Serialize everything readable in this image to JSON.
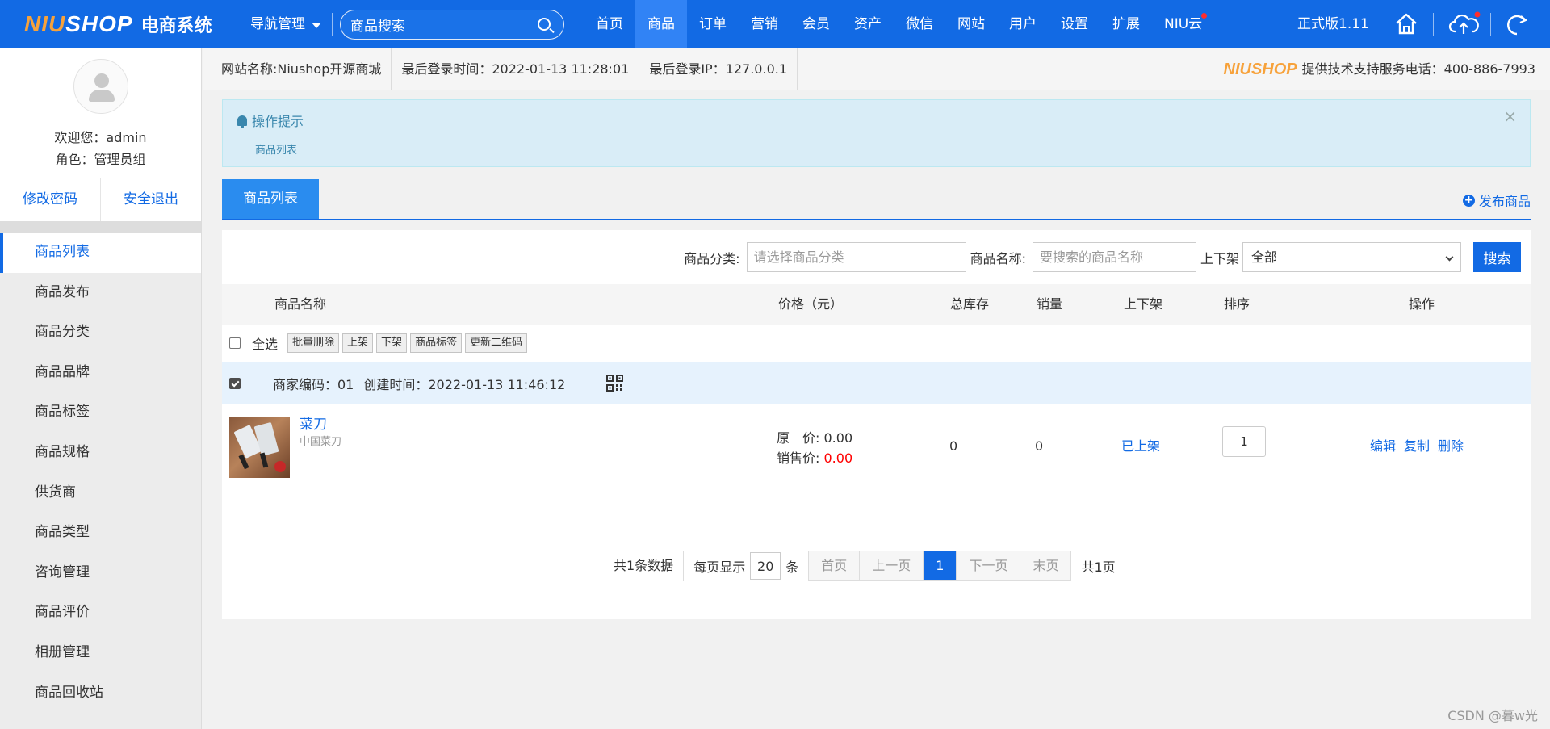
{
  "topbar": {
    "logo": {
      "part1": "NIU",
      "part2": "SHOP",
      "part3": "电商系统"
    },
    "nav_manage": "导航管理",
    "search_value": "商品搜索",
    "nav": [
      "首页",
      "商品",
      "订单",
      "营销",
      "会员",
      "资产",
      "微信",
      "网站",
      "用户",
      "设置",
      "扩展",
      "NIU云"
    ],
    "active_nav": "商品",
    "version": "正式版1.11",
    "icons": [
      "home-icon",
      "cloud-upload-icon",
      "refresh-icon"
    ]
  },
  "sidebar": {
    "welcome": "欢迎您：admin",
    "role": "角色：管理员组",
    "change_password": "修改密码",
    "logout": "安全退出",
    "menu": [
      "商品列表",
      "商品发布",
      "商品分类",
      "商品品牌",
      "商品标签",
      "商品规格",
      "供货商",
      "商品类型",
      "咨询管理",
      "商品评价",
      "相册管理",
      "商品回收站"
    ],
    "active_menu": "商品列表"
  },
  "infobar": {
    "site_name": "网站名称:Niushop开源商城",
    "last_login_time": "最后登录时间：2022-01-13 11:28:01",
    "last_login_ip": "最后登录IP：127.0.0.1",
    "brand_logo": {
      "part1": "NIU",
      "part2": "SHOP"
    },
    "support": "提供技术支持服务电话：400-886-7993"
  },
  "tip": {
    "title": "操作提示",
    "text": "商品列表",
    "close": "×"
  },
  "tabs": {
    "active": "商品列表",
    "publish": "发布商品"
  },
  "filters": {
    "category_label": "商品分类:",
    "category_placeholder": "请选择商品分类",
    "name_label": "商品名称:",
    "name_placeholder": "要搜索的商品名称",
    "status_label": "上下架",
    "status_value": "全部",
    "search_button": "搜索"
  },
  "table": {
    "headers": [
      "商品名称",
      "价格（元）",
      "总库存",
      "销量",
      "上下架",
      "排序",
      "操作"
    ],
    "select_all": "全选",
    "batch_buttons": [
      "批量删除",
      "上架",
      "下架",
      "商品标签",
      "更新二维码"
    ],
    "group": {
      "merchant_code": "商家编码：01",
      "created": "创建时间：2022-01-13 11:46:12"
    },
    "row": {
      "name": "菜刀",
      "subtitle": "中国菜刀",
      "original_price_label": "原　价:",
      "original_price": "0.00",
      "sale_price_label": "销售价:",
      "sale_price": "0.00",
      "stock": "0",
      "sales": "0",
      "status": "已上架",
      "sort": "1",
      "actions": [
        "编辑",
        "复制",
        "删除"
      ]
    }
  },
  "pager": {
    "total": "共1条数据",
    "per_page_label": "每页显示",
    "per_page": "20",
    "unit": "条",
    "first": "首页",
    "prev": "上一页",
    "current": "1",
    "next": "下一页",
    "last": "末页",
    "pages": "共1页"
  },
  "watermark": "CSDN @暮w光",
  "colors": {
    "primary": "#126ae4",
    "accent_orange": "#f7a23b",
    "tip_bg": "#d9edf7",
    "price_red": "#ff0000"
  }
}
